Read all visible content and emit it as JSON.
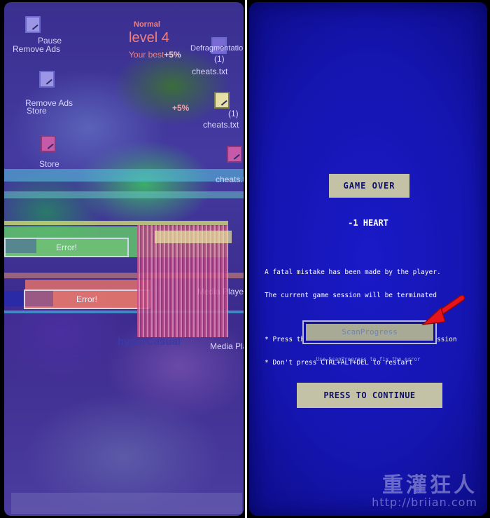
{
  "left_panel": {
    "desktop_items": [
      {
        "label": "Pause"
      },
      {
        "label": "Remove Ads"
      },
      {
        "label": "Remove Ads"
      },
      {
        "label": "Store"
      },
      {
        "label": "Store"
      },
      {
        "label": "Defragmentation"
      },
      {
        "label": "(1)"
      },
      {
        "label": "cheats.txt"
      },
      {
        "label": "cheats.txt"
      },
      {
        "label": "(1)"
      },
      {
        "label": "cheats.t"
      },
      {
        "label": "Media Player"
      },
      {
        "label": "Media Pla"
      },
      {
        "label": "hyperCasual"
      },
      {
        "label": "hyperCasual"
      }
    ],
    "hud": {
      "mode": "Normal",
      "level": "level 4",
      "best_label": "Your best",
      "best_value": "+5%",
      "bonus": "+5%"
    },
    "errors": [
      {
        "label": "Error!"
      },
      {
        "label": "Error!"
      }
    ]
  },
  "right_panel": {
    "banner": "GAME OVER",
    "heart_penalty": "-1 HEART",
    "message_line1": "A fatal mistake has been made by the player.",
    "message_line2": "The current game session will be terminated",
    "bullet1": "* Press the key to terminate the current session",
    "bullet2": "* Don't press CTRL+ALT+DEL to restart",
    "scan_button": "ScanProgress",
    "scan_hint": "Use ScanProgress to fix the error",
    "continue_button": "PRESS TO CONTINUE",
    "watermark_title": "重灌狂人",
    "watermark_url": "http://briian.com"
  },
  "colors": {
    "screen_blue": "#1515b0",
    "button_beige": "#c4c2a6",
    "arrow_red": "#e8141c"
  }
}
